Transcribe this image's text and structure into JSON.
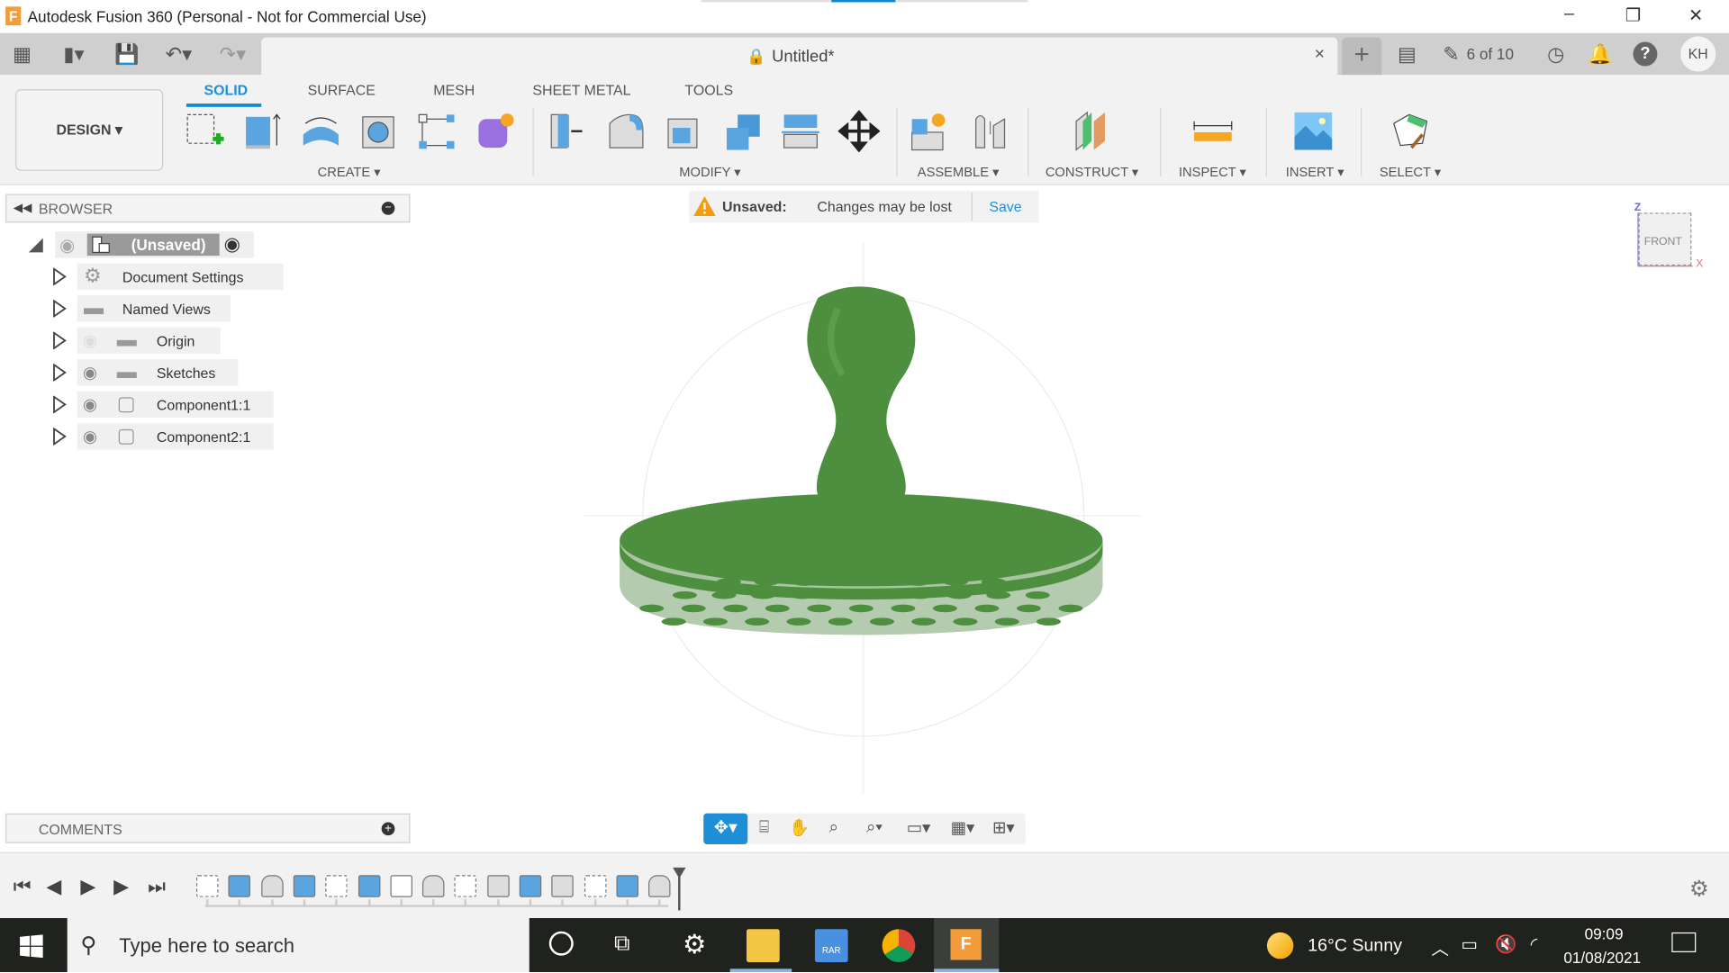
{
  "window": {
    "title": "Autodesk Fusion 360 (Personal - Not for Commercial Use)",
    "app_logo": "F"
  },
  "quick_access": {
    "icons": [
      "grid-apps-icon",
      "file-icon",
      "save-icon",
      "undo-icon",
      "redo-icon"
    ]
  },
  "document_tab": {
    "name": "Untitled*",
    "close": "×"
  },
  "header_right": {
    "jobs": "6 of 10",
    "user_initials": "KH"
  },
  "ribbon": {
    "workspace": "DESIGN ▾",
    "tabs": [
      "SOLID",
      "SURFACE",
      "MESH",
      "SHEET METAL",
      "TOOLS"
    ],
    "active_tab": "SOLID",
    "groups": {
      "create": "CREATE ▾",
      "modify": "MODIFY ▾",
      "assemble": "ASSEMBLE ▾",
      "construct": "CONSTRUCT ▾",
      "inspect": "INSPECT ▾",
      "insert": "INSERT ▾",
      "select": "SELECT ▾"
    }
  },
  "browser": {
    "title": "BROWSER",
    "root": "(Unsaved)",
    "items": [
      {
        "label": "Document Settings",
        "icon": "gear-icon",
        "visible": null
      },
      {
        "label": "Named Views",
        "icon": "folder-icon",
        "visible": null
      },
      {
        "label": "Origin",
        "icon": "folder-icon",
        "visible": false
      },
      {
        "label": "Sketches",
        "icon": "folder-icon",
        "visible": true
      },
      {
        "label": "Component1:1",
        "icon": "component-icon",
        "visible": true
      },
      {
        "label": "Component2:1",
        "icon": "component-icon",
        "visible": true
      }
    ]
  },
  "banner": {
    "label": "Unsaved:",
    "message": "Changes may be lost",
    "action": "Save"
  },
  "viewcube": {
    "face": "FRONT",
    "axes": {
      "z": "Z",
      "x": "X"
    }
  },
  "comments": {
    "title": "COMMENTS"
  },
  "timeline": {
    "features": [
      "sketch",
      "extrude",
      "fillet",
      "extrude",
      "sketch",
      "extrude",
      "pattern",
      "fillet",
      "sketch",
      "box",
      "extrude",
      "move",
      "sketch",
      "revolve",
      "fillet"
    ]
  },
  "taskbar": {
    "search_placeholder": "Type here to search",
    "weather": "16°C  Sunny",
    "time": "09:09",
    "date": "01/08/2021"
  },
  "colors": {
    "accent": "#0a8ad6",
    "model_green": "#4f8f3f",
    "taskbar": "#20221e",
    "warning": "#f39c12"
  }
}
